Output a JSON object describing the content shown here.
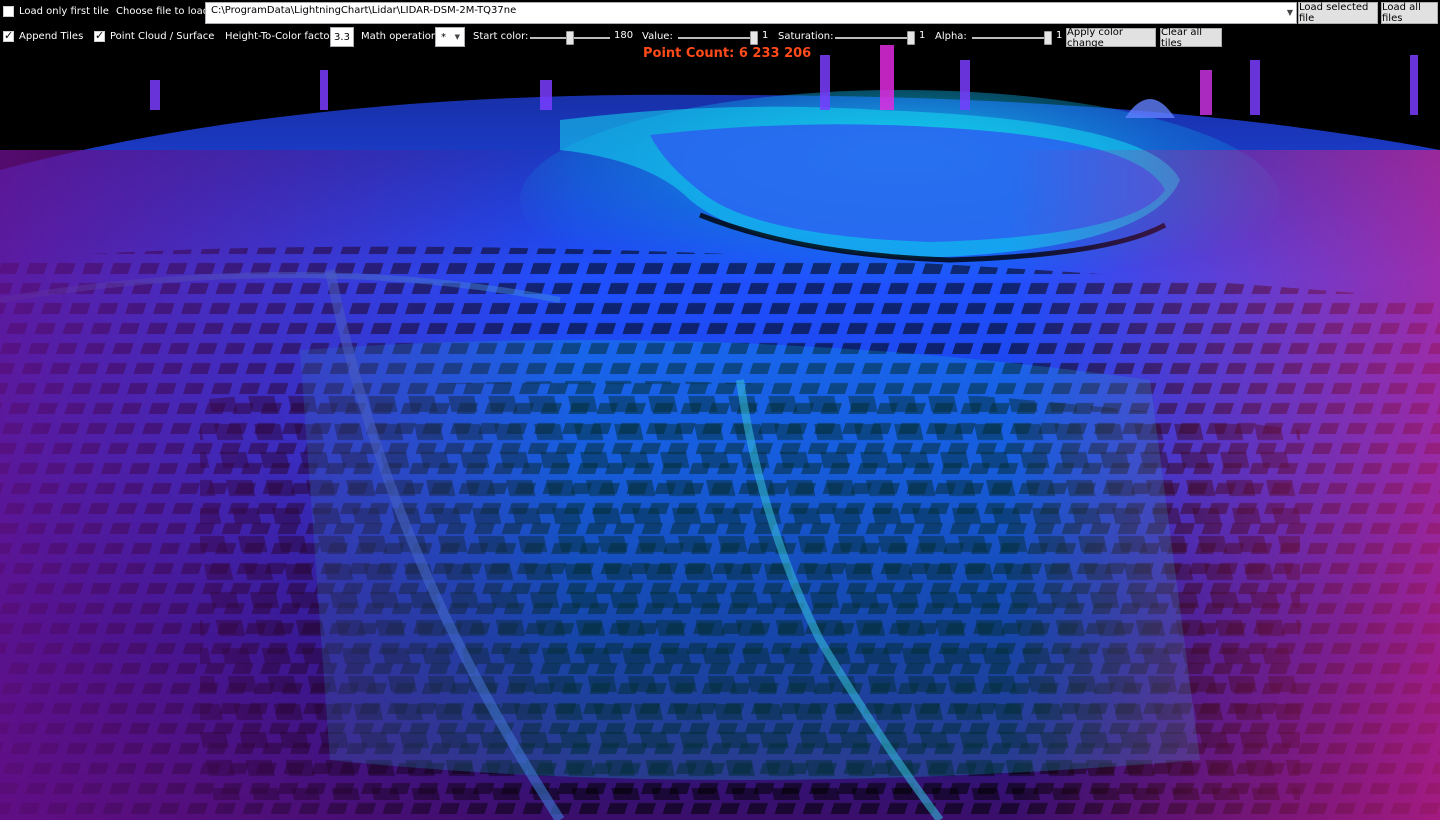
{
  "toolbar": {
    "load_only_first_tile": {
      "label": "Load only first tile",
      "checked": false
    },
    "choose_file_label": "Choose file to load:",
    "file_path": "C:\\ProgramData\\LightningChart\\Lidar\\LIDAR-DSM-2M-TQ37ne",
    "load_selected_label": "Load selected file",
    "load_all_label": "Load all files",
    "append_tiles": {
      "label": "Append Tiles",
      "checked": true
    },
    "point_cloud_surface": {
      "label": "Point Cloud / Surface",
      "checked": true
    },
    "height_to_color_label": "Height-To-Color factor",
    "height_to_color_value": "3.3",
    "math_operation_label": "Math operation",
    "math_operation_value": "*",
    "start_color_label": "Start color:",
    "start_color_value": "180",
    "start_color_fraction": 0.5,
    "value_label": "Value:",
    "value_value": "1",
    "value_fraction": 1.0,
    "saturation_label": "Saturation:",
    "saturation_value": "1",
    "saturation_fraction": 1.0,
    "alpha_label": "Alpha:",
    "alpha_value": "1",
    "alpha_fraction": 1.0,
    "apply_color_label": "Apply color change",
    "clear_tiles_label": "Clear all tiles"
  },
  "status": {
    "point_count": "Point Count: 6 233 206"
  },
  "colors": {
    "point_count_text": "#ff4a1a",
    "low_elevation": "#00ffee",
    "mid_elevation": "#1e3cff",
    "high_elevation": "#ff20c8"
  }
}
